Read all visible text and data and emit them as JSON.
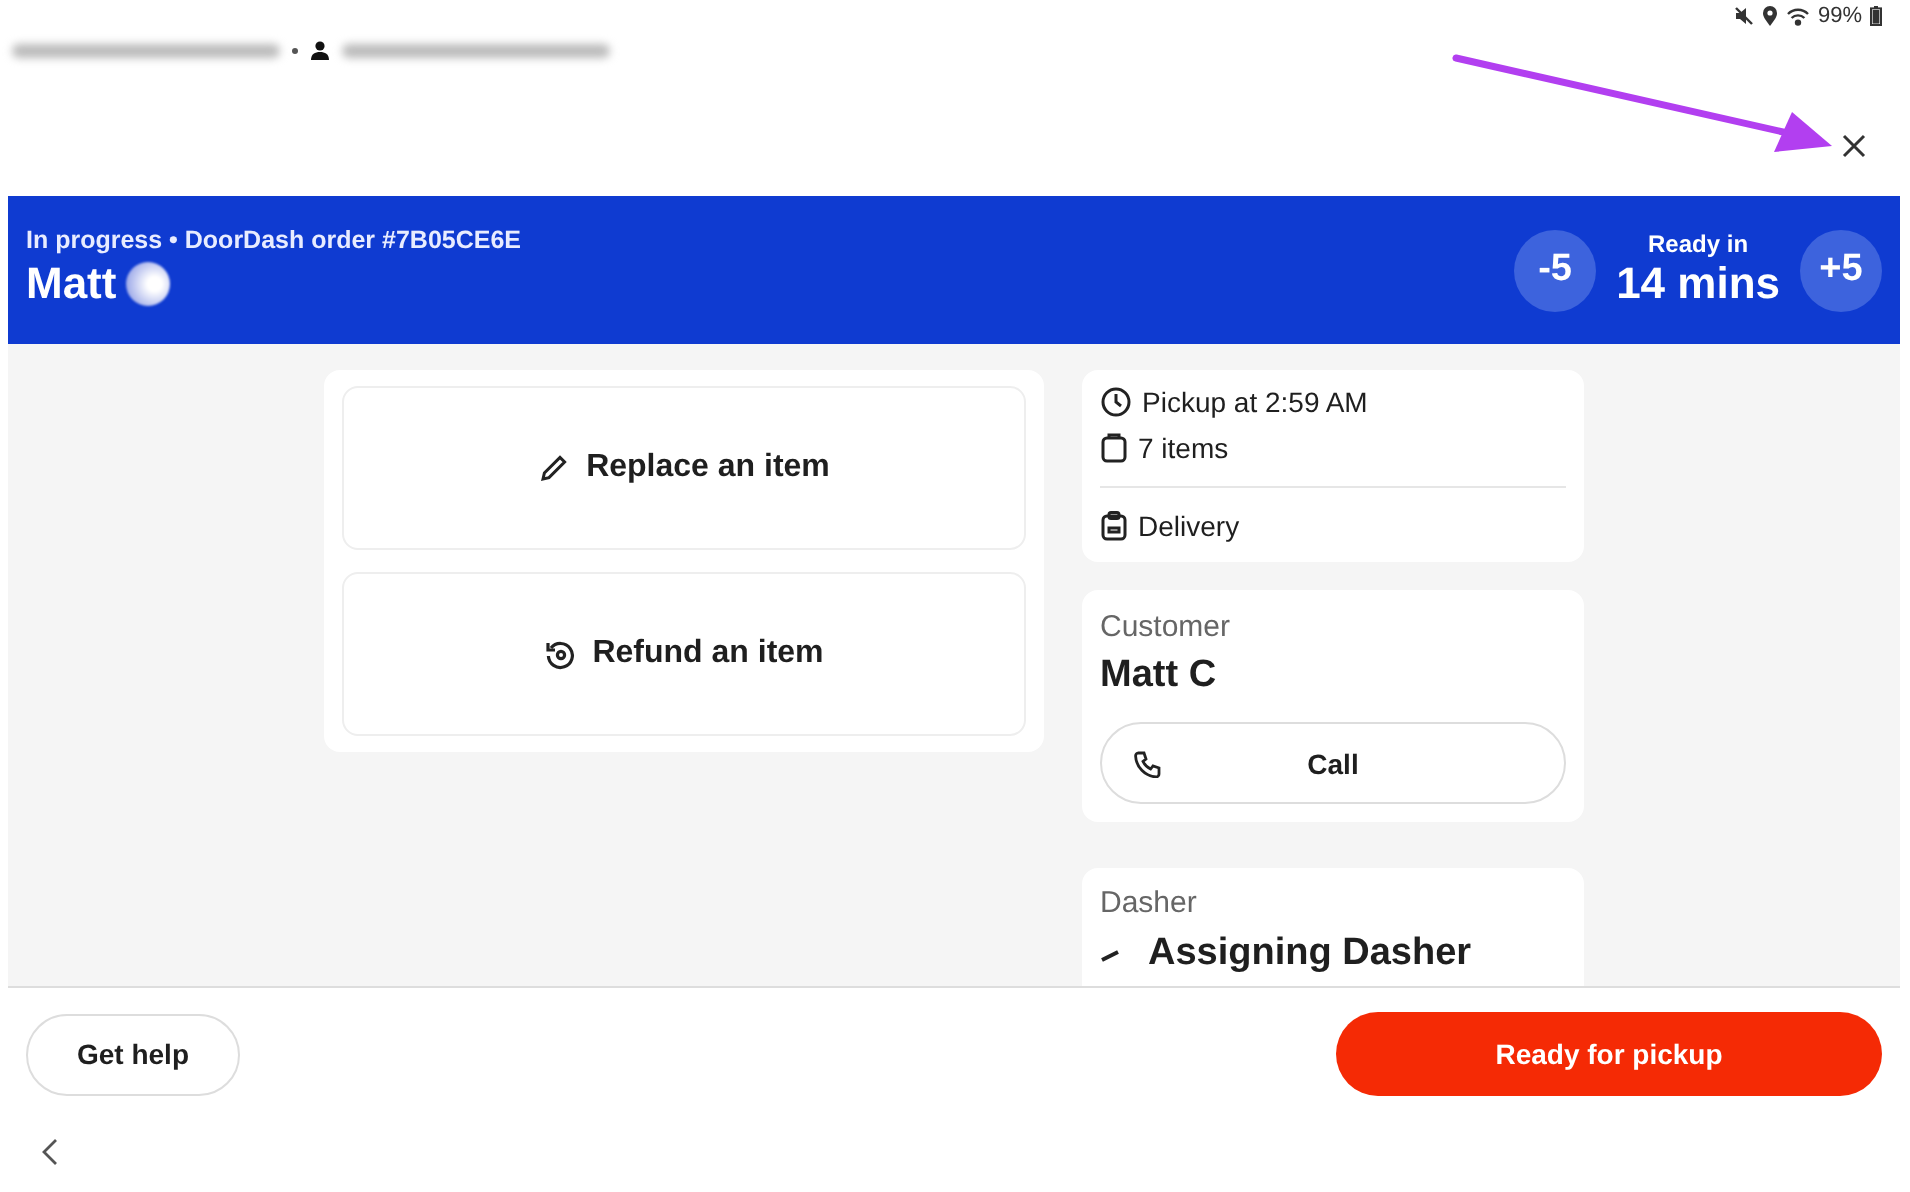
{
  "status_bar": {
    "battery": "99%"
  },
  "header": {
    "status_line": "In progress • DoorDash order #7B05CE6E",
    "customer_name": "Matt",
    "minus_button": "-5",
    "ready_label": "Ready in",
    "ready_time": "14 mins",
    "plus_button": "+5"
  },
  "actions": [
    {
      "kind": "replace",
      "label": "Replace an item"
    },
    {
      "kind": "refund",
      "label": "Refund an item"
    }
  ],
  "order_info": {
    "groups": [
      [
        {
          "kind": "clock",
          "text": "Pickup at 2:59 AM"
        },
        {
          "kind": "bag",
          "text": "7 items"
        }
      ],
      [
        {
          "kind": "delivery",
          "text": "Delivery"
        }
      ]
    ]
  },
  "customer": {
    "heading": "Customer",
    "name": "Matt C",
    "call_button": "Call"
  },
  "dasher": {
    "heading": "Dasher",
    "status": "Assigning Dasher"
  },
  "footer": {
    "help_button": "Get help",
    "ready_button": "Ready for pickup"
  }
}
